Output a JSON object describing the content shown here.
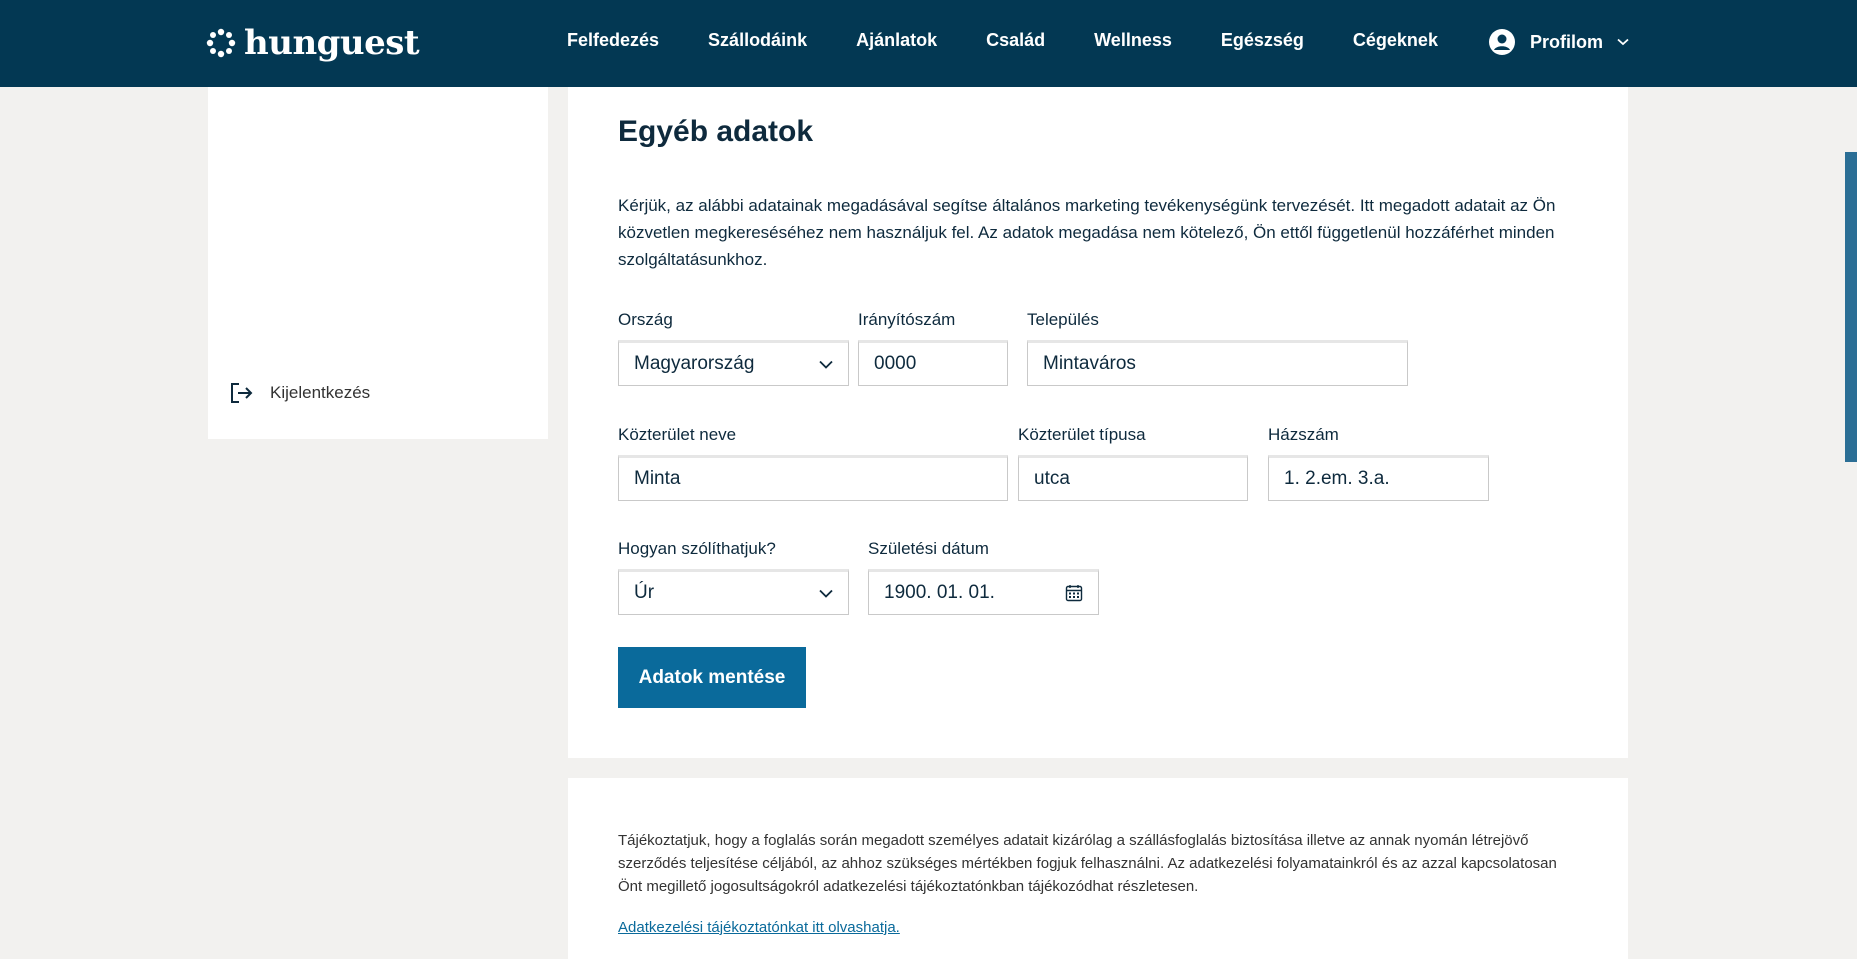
{
  "header": {
    "logo_text": "hunguest",
    "nav": [
      "Felfedezés",
      "Szállodáink",
      "Ajánlatok",
      "Család",
      "Wellness",
      "Egészség",
      "Cégeknek"
    ],
    "profile_label": "Profilom"
  },
  "sidebar": {
    "logout_label": "Kijelentkezés"
  },
  "form": {
    "title": "Egyéb adatok",
    "intro": "Kérjük, az alábbi adatainak megadásával segítse általános marketing tevékenységünk tervezését. Itt megadott adatait az Ön közvetlen megkereséséhez nem használjuk fel. Az adatok megadása nem kötelező, Ön ettől függetlenül hozzáférhet minden szolgáltatásunkhoz.",
    "country": {
      "label": "Ország",
      "value": "Magyarország"
    },
    "zip": {
      "label": "Irányítószám",
      "value": "0000"
    },
    "city": {
      "label": "Település",
      "value": "Mintaváros"
    },
    "street_name": {
      "label": "Közterület neve",
      "value": "Minta"
    },
    "street_type": {
      "label": "Közterület típusa",
      "value": "utca"
    },
    "house_number": {
      "label": "Házszám",
      "value": "1. 2.em. 3.a."
    },
    "salutation": {
      "label": "Hogyan szólíthatjuk?",
      "value": "Úr"
    },
    "birth_date": {
      "label": "Születési dátum",
      "value": "1900. 01. 01."
    },
    "save_label": "Adatok mentése"
  },
  "info": {
    "text": "Tájékoztatjuk, hogy a foglalás során megadott személyes adatait kizárólag a szállásfoglalás biztosítása illetve az annak nyomán létrejövő szerződés teljesítése céljából, az ahhoz szükséges mértékben fogjuk felhasználni. Az adatkezelési folyamatainkról és az azzal kapcsolatosan Önt megillető jogosultságokról adatkezelési tájékoztatónkban tájékozódhat részletesen.",
    "link": "Adatkezelési tájékoztatónkat itt olvashatja."
  },
  "colors": {
    "header_bg": "#033853",
    "primary_button": "#0a6a9b",
    "page_bg": "#f2f1ef"
  }
}
